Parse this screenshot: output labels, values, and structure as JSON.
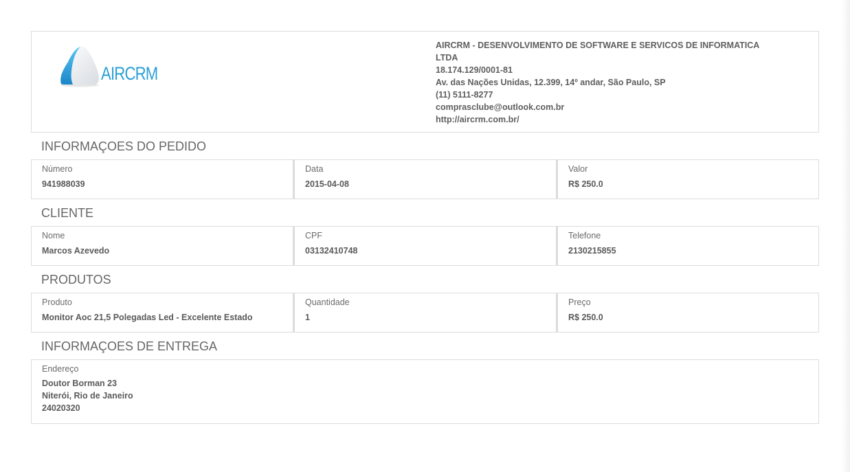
{
  "company": {
    "logo_text": "AIRCRM",
    "name_line1": "AIRCRM - DESENVOLVIMENTO DE SOFTWARE E SERVICOS DE INFORMATICA",
    "name_line2": "LTDA",
    "cnpj": "18.174.129/0001-81",
    "address": "Av. das Nações Unidas, 12.399, 14º andar, São Paulo, SP",
    "phone": "(11) 5111-8277",
    "email": "comprasclube@outlook.com.br",
    "website": "http://aircrm.com.br/",
    "brand_color": "#2b9fd6"
  },
  "order": {
    "title": "INFORMAÇOES DO PEDIDO",
    "number_label": "Número",
    "number_value": "941988039",
    "date_label": "Data",
    "date_value": "2015-04-08",
    "amount_label": "Valor",
    "amount_value": "R$ 250.0"
  },
  "client": {
    "title": "CLIENTE",
    "name_label": "Nome",
    "name_value": "Marcos Azevedo",
    "cpf_label": "CPF",
    "cpf_value": "03132410748",
    "phone_label": "Telefone",
    "phone_value": "2130215855"
  },
  "products": {
    "title": "PRODUTOS",
    "product_label": "Produto",
    "product_value": "Monitor Aoc 21,5 Polegadas Led - Excelente Estado",
    "quantity_label": "Quantidade",
    "quantity_value": "1",
    "price_label": "Preço",
    "price_value": "R$ 250.0"
  },
  "delivery": {
    "title": "INFORMAÇOES DE ENTREGA",
    "address_label": "Endereço",
    "street": "Doutor Borman 23",
    "city": "Niterói, Rio de Janeiro",
    "zip": "24020320"
  }
}
